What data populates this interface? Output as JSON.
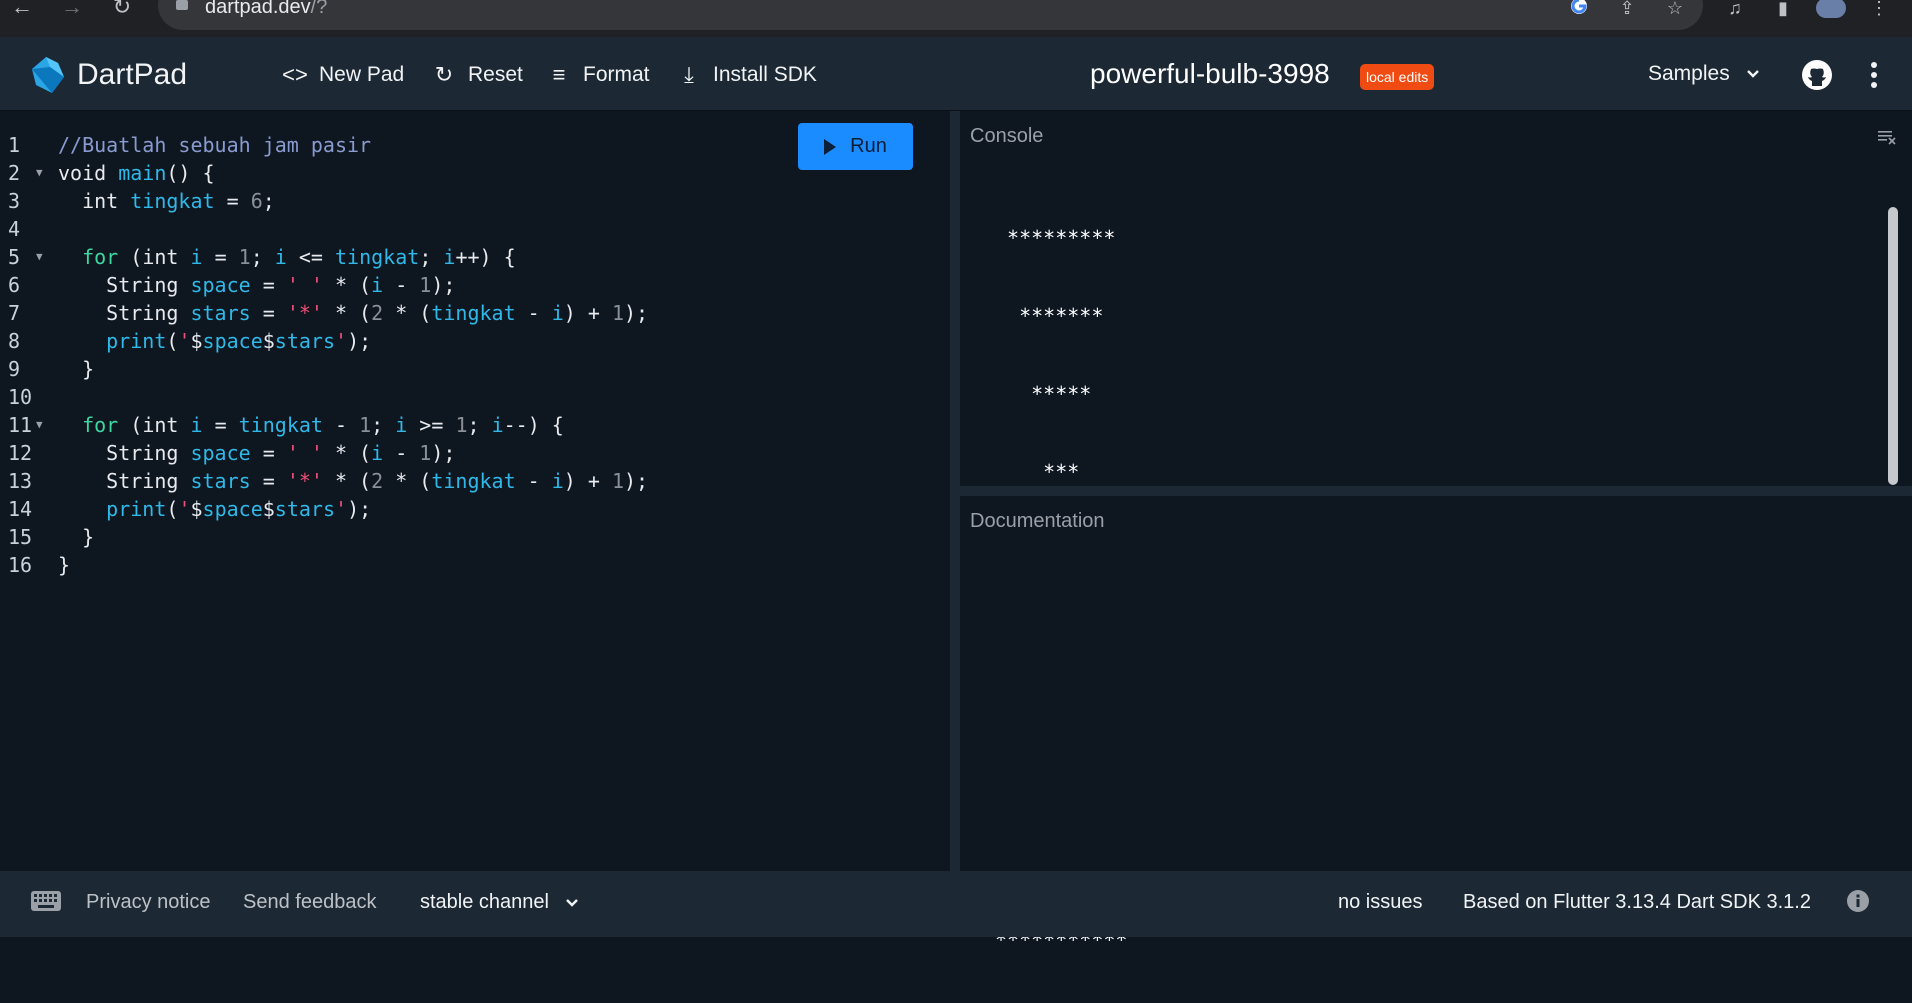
{
  "browser": {
    "url_host": "dartpad.dev",
    "url_path": "/?"
  },
  "header": {
    "app_title": "DartPad",
    "new_pad_label": "New Pad",
    "reset_label": "Reset",
    "format_label": "Format",
    "install_sdk_label": "Install SDK",
    "pad_name": "powerful-bulb-3998",
    "local_edits_badge": "local edits",
    "samples_label": "Samples"
  },
  "editor": {
    "run_label": "Run",
    "line_numbers": [
      "1",
      "2",
      "3",
      "4",
      "5",
      "6",
      "7",
      "8",
      "9",
      "10",
      "11",
      "12",
      "13",
      "14",
      "15",
      "16"
    ],
    "code_lines": [
      "//Buatlah sebuah jam pasir",
      "void main() {",
      "  int tingkat = 6;",
      "",
      "  for (int i = 1; i <= tingkat; i++) {",
      "    String space = ' ' * (i - 1);",
      "    String stars = '*' * (2 * (tingkat - i) + 1);",
      "    print('$space$stars');",
      "  }",
      "",
      "  for (int i = tingkat - 1; i >= 1; i--) {",
      "    String space = ' ' * (i - 1);",
      "    String stars = '*' * (2 * (tingkat - i) + 1);",
      "    print('$space$stars');",
      "  }",
      "}"
    ]
  },
  "console": {
    "title": "Console",
    "output_lines": [
      " *********",
      "  *******",
      "   *****",
      "    ***",
      "     *",
      "    ***",
      "   *****",
      "  *******",
      " *********",
      "***********"
    ]
  },
  "docs": {
    "title": "Documentation"
  },
  "footer": {
    "privacy_notice": "Privacy notice",
    "send_feedback": "Send feedback",
    "channel": "stable channel",
    "issues": "no issues",
    "version": "Based on Flutter 3.13.4 Dart SDK 3.1.2"
  },
  "colors": {
    "accent": "#1a8cff",
    "badge": "#ef4b12",
    "header_bg": "#1c2834",
    "editor_bg": "#0e1620"
  }
}
